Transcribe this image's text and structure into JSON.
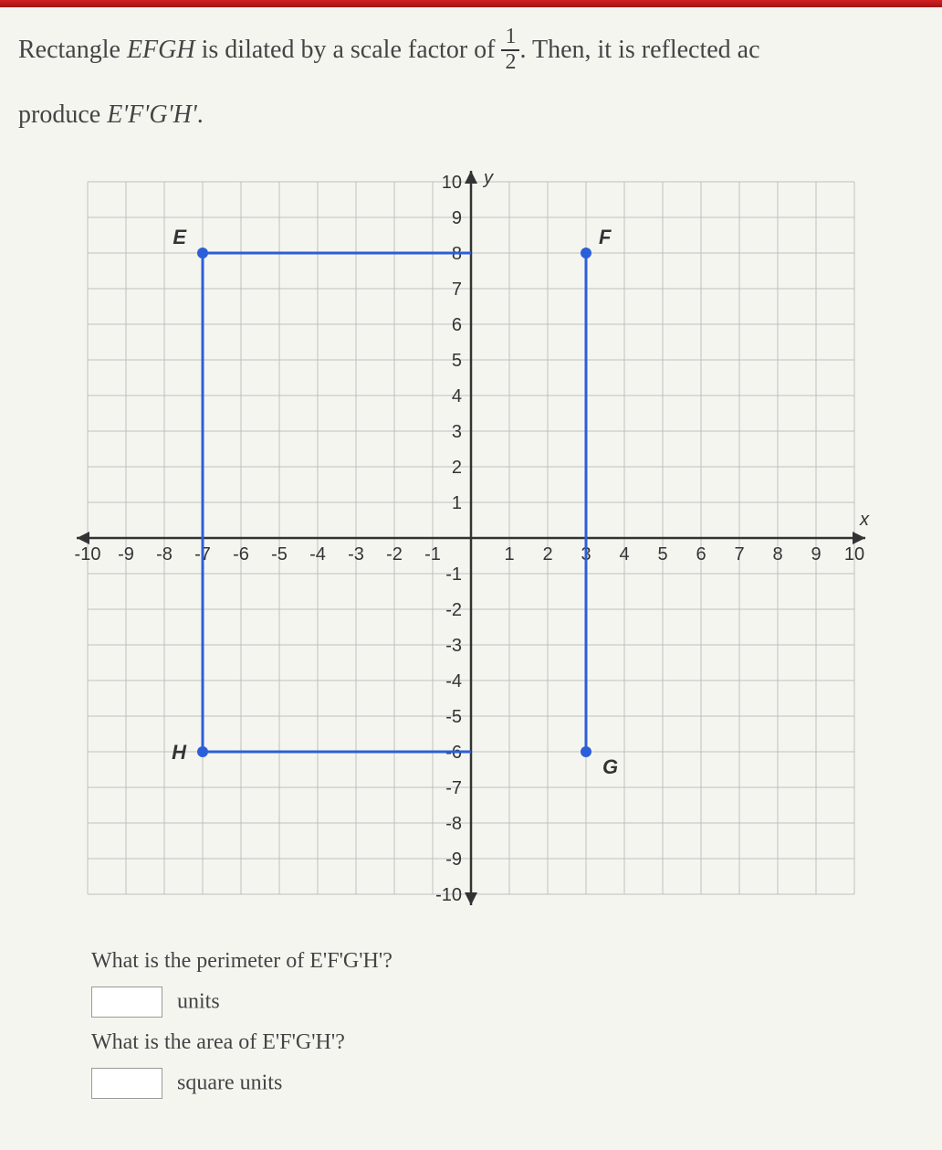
{
  "problem": {
    "line1_prefix": "Rectangle ",
    "shape_name": "EFGH",
    "line1_mid": " is dilated by a scale factor of ",
    "frac_num": "1",
    "frac_den": "2",
    "line1_suffix": ". Then, it is reflected ac",
    "line2_prefix": "produce ",
    "result_name": "E'F'G'H'",
    "line2_suffix": "."
  },
  "chart_data": {
    "type": "scatter",
    "title": "",
    "xlabel": "x",
    "ylabel": "y",
    "xlim": [
      -10,
      10
    ],
    "ylim": [
      -10,
      10
    ],
    "x_ticks": [
      -10,
      -9,
      -8,
      -7,
      -6,
      -5,
      -4,
      -3,
      -2,
      -1,
      1,
      2,
      3,
      4,
      5,
      6,
      7,
      8,
      9,
      10
    ],
    "y_ticks": [
      -10,
      -9,
      -8,
      -7,
      -6,
      -5,
      -4,
      -3,
      -2,
      -1,
      1,
      2,
      3,
      4,
      5,
      6,
      7,
      8,
      9,
      10
    ],
    "vertices": [
      {
        "name": "E",
        "x": -7,
        "y": 8
      },
      {
        "name": "F",
        "x": 3,
        "y": 8
      },
      {
        "name": "G",
        "x": 3,
        "y": -6
      },
      {
        "name": "H",
        "x": -7,
        "y": -6
      }
    ],
    "segments": [
      {
        "from": "E",
        "to": "H"
      },
      {
        "from": "F",
        "to": "G"
      },
      {
        "from": "H",
        "to": "G",
        "partial_to_x": 0
      },
      {
        "from": "E",
        "to": "F",
        "partial_to_x": 0
      }
    ]
  },
  "questions": {
    "q1": "What is the perimeter of E'F'G'H'?",
    "q1_units": "units",
    "q2": "What is the area of E'F'G'H'?",
    "q2_units": "square units"
  }
}
